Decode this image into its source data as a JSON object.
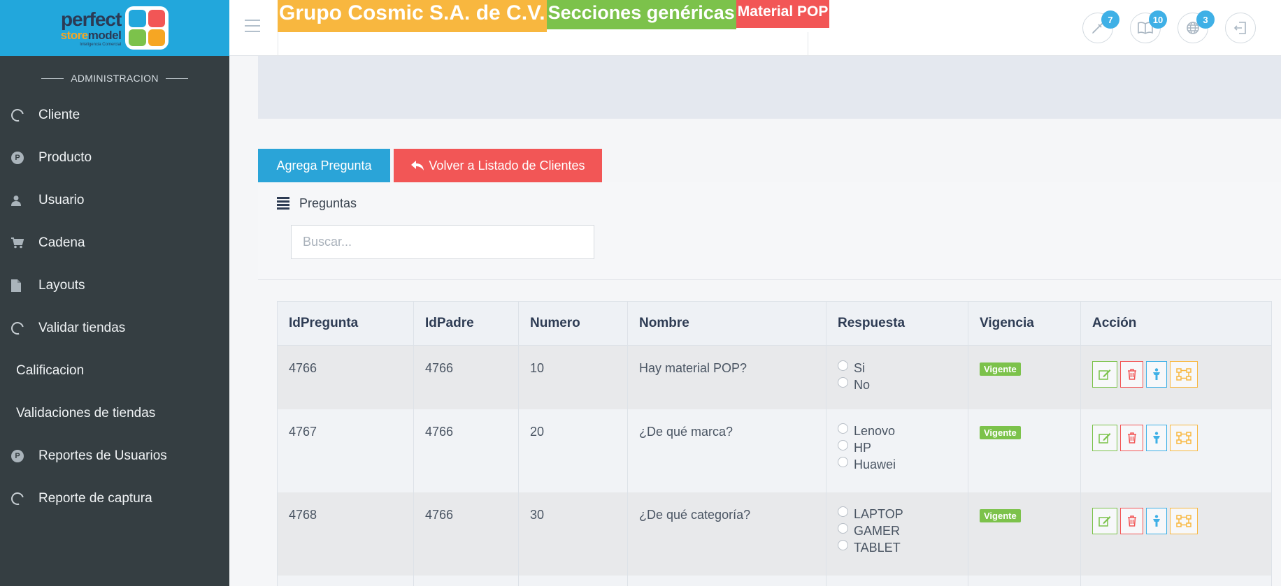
{
  "logo": {
    "line1": "perfect",
    "line2a": "store",
    "line2b": "model",
    "tagline": "Inteligencia Comercial",
    "colors": [
      "#f6a623",
      "#22a7dc",
      "#7cc24b",
      "#f25656"
    ]
  },
  "sidebar": {
    "section_title": "ADMINISTRACION",
    "items": [
      {
        "label": "Cliente",
        "icon": "refresh-icon"
      },
      {
        "label": "Producto",
        "icon": "product-p-icon"
      },
      {
        "label": "Usuario",
        "icon": "user-icon"
      },
      {
        "label": "Cadena",
        "icon": "cart-icon"
      },
      {
        "label": "Layouts",
        "icon": "file-icon"
      },
      {
        "label": "Validar tiendas",
        "icon": "refresh-icon"
      },
      {
        "label": "Calificacion",
        "icon": ""
      },
      {
        "label": "Validaciones de tiendas",
        "icon": ""
      },
      {
        "label": "Reportes de Usuarios",
        "icon": "product-p-icon"
      },
      {
        "label": "Reporte de captura",
        "icon": "refresh-icon"
      }
    ]
  },
  "header": {
    "breadcrumb": [
      "Grupo Cosmic S.A. de C.V.",
      "Secciones genéricas",
      "Material POP"
    ],
    "badges": {
      "brush": "7",
      "book": "10",
      "globe": "3"
    }
  },
  "main": {
    "add_button": "Agrega Pregunta",
    "back_button": "Volver a Listado de Clientes",
    "panel_title": "Preguntas",
    "search_placeholder": "Buscar..."
  },
  "table": {
    "columns": [
      "IdPregunta",
      "IdPadre",
      "Numero",
      "Nombre",
      "Respuesta",
      "Vigencia",
      "Acción"
    ],
    "rows": [
      {
        "id": "4766",
        "padre": "4766",
        "numero": "10",
        "nombre": "Hay material POP?",
        "respuestas": [
          "Si",
          "No"
        ],
        "vigencia": "Vigente"
      },
      {
        "id": "4767",
        "padre": "4766",
        "numero": "20",
        "nombre": "¿De qué marca?",
        "respuestas": [
          "Lenovo",
          "HP",
          "Huawei"
        ],
        "vigencia": "Vigente"
      },
      {
        "id": "4768",
        "padre": "4766",
        "numero": "30",
        "nombre": "¿De qué categoría?",
        "respuestas": [
          "LAPTOP",
          "GAMER",
          "TABLET"
        ],
        "vigencia": "Vigente"
      }
    ]
  }
}
